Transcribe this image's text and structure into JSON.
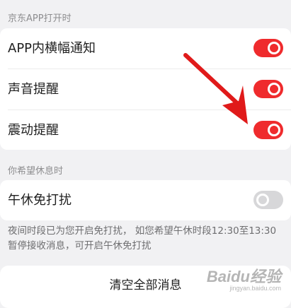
{
  "sections": {
    "open_header": "京东APP打开时",
    "rest_header": "你希望休息时"
  },
  "rows": {
    "banner": {
      "label": "APP内横幅通知",
      "enabled": true
    },
    "sound": {
      "label": "声音提醒",
      "enabled": true
    },
    "vibrate": {
      "label": "震动提醒",
      "enabled": true
    },
    "nap": {
      "label": "午休免打扰",
      "enabled": false
    }
  },
  "note": "夜间时段已为您开启免打扰， 如您希望午休时段12:30至13:30暂停接收消息，可开启午休免打扰",
  "clear_button": "清空全部消息",
  "watermark": {
    "brand": "Baidu经验",
    "url": "jingyan.baidu.com"
  },
  "colors": {
    "toggle_on": "#ef2b2d",
    "toggle_off": "#d7d7d9",
    "arrow": "#e01a1a"
  }
}
